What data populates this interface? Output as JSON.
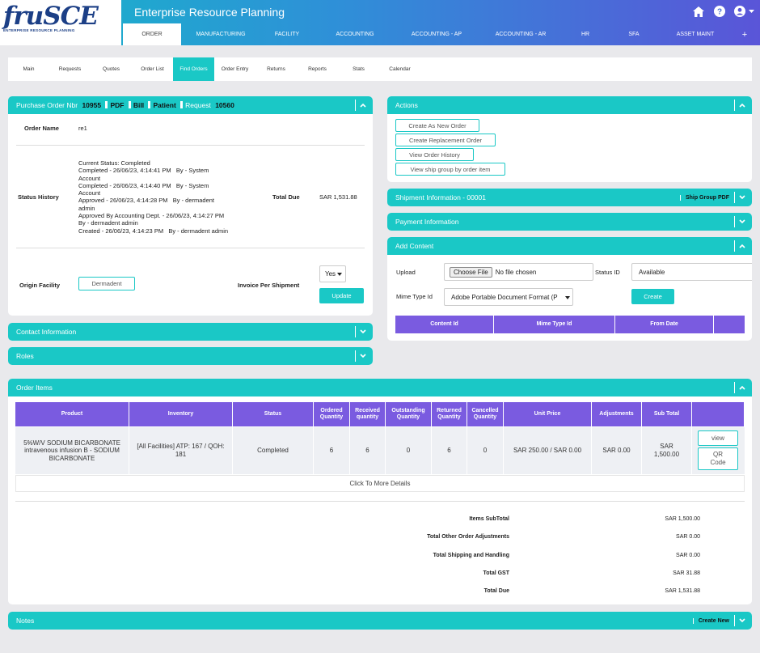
{
  "app": {
    "logo": "fruSCE",
    "logo_sub": "ENTERPRISE RESOURCE PLANNING",
    "title": "Enterprise Resource Planning"
  },
  "top_menu": [
    {
      "label": "ORDER",
      "active": true,
      "w": 72
    },
    {
      "label": "MANUFACTURING",
      "active": false,
      "w": 98
    },
    {
      "label": "FACILITY",
      "active": false,
      "w": 66
    },
    {
      "label": "ACCOUNTING",
      "active": false,
      "w": 102
    },
    {
      "label": "ACCOUNTING - AP",
      "active": false,
      "w": 100
    },
    {
      "label": "ACCOUNTING - AR",
      "active": false,
      "w": 108
    },
    {
      "label": "HR",
      "active": false,
      "w": 52
    },
    {
      "label": "SFA",
      "active": false,
      "w": 68
    },
    {
      "label": "ASSET MAINT",
      "active": false,
      "w": 84
    },
    {
      "label": "+",
      "active": false,
      "w": 38
    }
  ],
  "sub_nav": [
    {
      "label": "Main",
      "active": false
    },
    {
      "label": "Requests",
      "active": false
    },
    {
      "label": "Quotes",
      "active": false
    },
    {
      "label": "Order List",
      "active": false
    },
    {
      "label": "Find Orders",
      "active": true
    },
    {
      "label": "Order Entry",
      "active": false
    },
    {
      "label": "Returns",
      "active": false
    },
    {
      "label": "Reports",
      "active": false
    },
    {
      "label": "Stats",
      "active": false
    },
    {
      "label": "Calendar",
      "active": false
    }
  ],
  "po": {
    "header_prefix": "Purchase Order Nbr",
    "order_nbr": "10955",
    "pdf": "PDF",
    "bill": "Bill",
    "patient": "Patient",
    "request_label": "Request",
    "request_nbr": "10560",
    "order_name_label": "Order Name",
    "order_name": "re1",
    "status_history_label": "Status History",
    "status_lines": [
      "Current Status: Completed",
      "Completed - 26/06/23, 4:14:41 PM   By - System",
      "Account",
      "Completed - 26/06/23, 4:14:40 PM   By - System",
      "Account",
      "Approved - 26/06/23, 4:14:28 PM   By - dermadent",
      "admin",
      "Approved By Accounting Dept. - 26/06/23, 4:14:27 PM",
      "By - dermadent admin",
      "Created - 26/06/23, 4:14:23 PM   By - dermadent admin"
    ],
    "total_due_label": "Total Due",
    "total_due": "SAR 1,531.88",
    "origin_facility_label": "Origin Facility",
    "origin_facility": "Dermadent",
    "invoice_per_shipment_label": "Invoice Per Shipment",
    "invoice_value": "Yes",
    "update_label": "Update"
  },
  "contact_info": {
    "title": "Contact Information"
  },
  "roles": {
    "title": "Roles"
  },
  "actions": {
    "title": "Actions",
    "buttons": [
      "Create As New Order",
      "Create Replacement Order",
      "View Order History",
      "View ship group by order item"
    ]
  },
  "shipment": {
    "title": "Shipment Information - 00001",
    "pdf_label": "Ship Group PDF"
  },
  "payment": {
    "title": "Payment Information"
  },
  "add_content": {
    "title": "Add Content",
    "upload_label": "Upload",
    "choose_file": "Choose File",
    "no_file": "No file chosen",
    "status_id_label": "Status ID",
    "status_id": "Available",
    "mime_type_label": "Mime Type Id",
    "mime_type": "Adobe Portable Document Format (P",
    "create_label": "Create",
    "columns": [
      "Content Id",
      "Mime Type Id",
      "From Date",
      ""
    ]
  },
  "order_items": {
    "title": "Order Items",
    "columns": [
      "Product",
      "Inventory",
      "Status",
      "Ordered Quantity",
      "Received quantity",
      "Outstanding Quantity",
      "Returned Quantity",
      "Cancelled Quantity",
      "Unit Price",
      "Adjustments",
      "Sub Total",
      ""
    ],
    "row": {
      "product": "5%W/V SODIUM BICARBONATE intravenous infusion B - SODIUM BICARBONATE",
      "inventory": "[All Facilities] ATP: 167 / QOH: 181",
      "status": "Completed",
      "ordered": "6",
      "received": "6",
      "outstanding": "0",
      "returned": "6",
      "cancelled": "0",
      "unit_price": "SAR 250.00 / SAR 0.00",
      "adjustments": "SAR 0.00",
      "sub_total": "SAR 1,500.00",
      "view_label": "view",
      "qr_label": "QR Code"
    },
    "more_details": "Click To More Details",
    "totals": [
      {
        "label": "Items SubTotal",
        "value": "SAR 1,500.00"
      },
      {
        "label": "Total Other Order Adjustments",
        "value": "SAR 0.00"
      },
      {
        "label": "Total Shipping and Handling",
        "value": "SAR 0.00"
      },
      {
        "label": "Total GST",
        "value": "SAR 31.88"
      },
      {
        "label": "Total Due",
        "value": "SAR 1,531.88"
      }
    ]
  },
  "notes": {
    "title": "Notes",
    "create_new": "Create New"
  },
  "colors": {
    "accent": "#1ac8c6",
    "table_header": "#7a5be0",
    "brand": "#1c3f86"
  }
}
